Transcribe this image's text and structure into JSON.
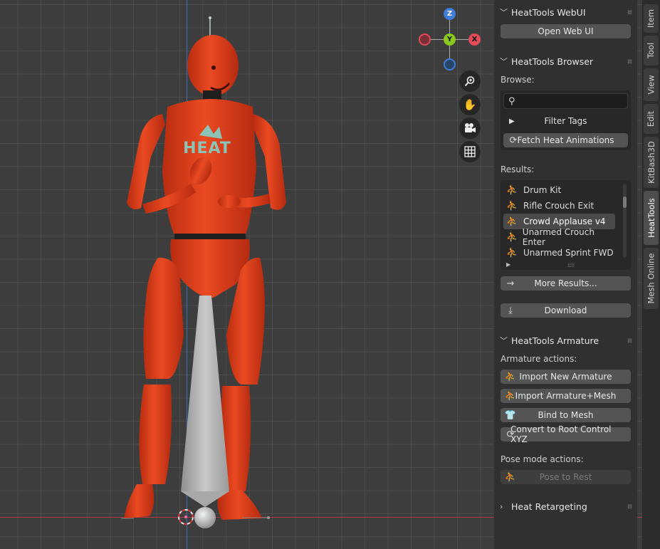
{
  "viewport": {
    "gizmo": {
      "x": "X",
      "y": "Y",
      "z": "Z"
    },
    "nav_icons": [
      "zoom-icon",
      "hand-pan-icon",
      "camera-icon",
      "grid-icon"
    ],
    "model_logo_text": "HEAT"
  },
  "webui_panel": {
    "title": "HeatTools WebUI",
    "open_button": "Open Web UI"
  },
  "browser_panel": {
    "title": "HeatTools Browser",
    "browse_label": "Browse:",
    "search_placeholder": "",
    "filter_tags": "Filter Tags",
    "fetch_button": "Fetch Heat Animations",
    "results_label": "Results:",
    "results": [
      {
        "label": "Drum Kit",
        "selected": false
      },
      {
        "label": "Rifle Crouch Exit",
        "selected": false
      },
      {
        "label": "Crowd Applause v4",
        "selected": true
      },
      {
        "label": "Unarmed Crouch Enter",
        "selected": false
      },
      {
        "label": "Unarmed Sprint FWD",
        "selected": false
      }
    ],
    "more_results": "More Results...",
    "download": "Download"
  },
  "armature_panel": {
    "title": "HeatTools Armature",
    "armature_label": "Armature actions:",
    "import_new": "Import New Armature",
    "import_mesh": "Import Armature+Mesh",
    "bind": "Bind to Mesh",
    "convert": "Convert to Root Control XYZ",
    "pose_label": "Pose mode actions:",
    "pose_rest": "Pose to Rest"
  },
  "retarget_panel": {
    "title": "Heat Retargeting"
  },
  "tabs": [
    {
      "label": "Item",
      "active": false
    },
    {
      "label": "Tool",
      "active": false
    },
    {
      "label": "View",
      "active": false
    },
    {
      "label": "Edit",
      "active": false
    },
    {
      "label": "KitBash3D",
      "active": false
    },
    {
      "label": "HeatTools",
      "active": true
    },
    {
      "label": "Mesh Online",
      "active": false
    }
  ],
  "colors": {
    "viewport_bg": "#3d3d3d",
    "grid": "#4e4e4e",
    "model_orange": "#e0401c",
    "axis_x": "#e04a59",
    "axis_y": "#8ac81e",
    "axis_z": "#3f7dd6",
    "panel_bg": "#303030",
    "button_bg": "#545454"
  }
}
